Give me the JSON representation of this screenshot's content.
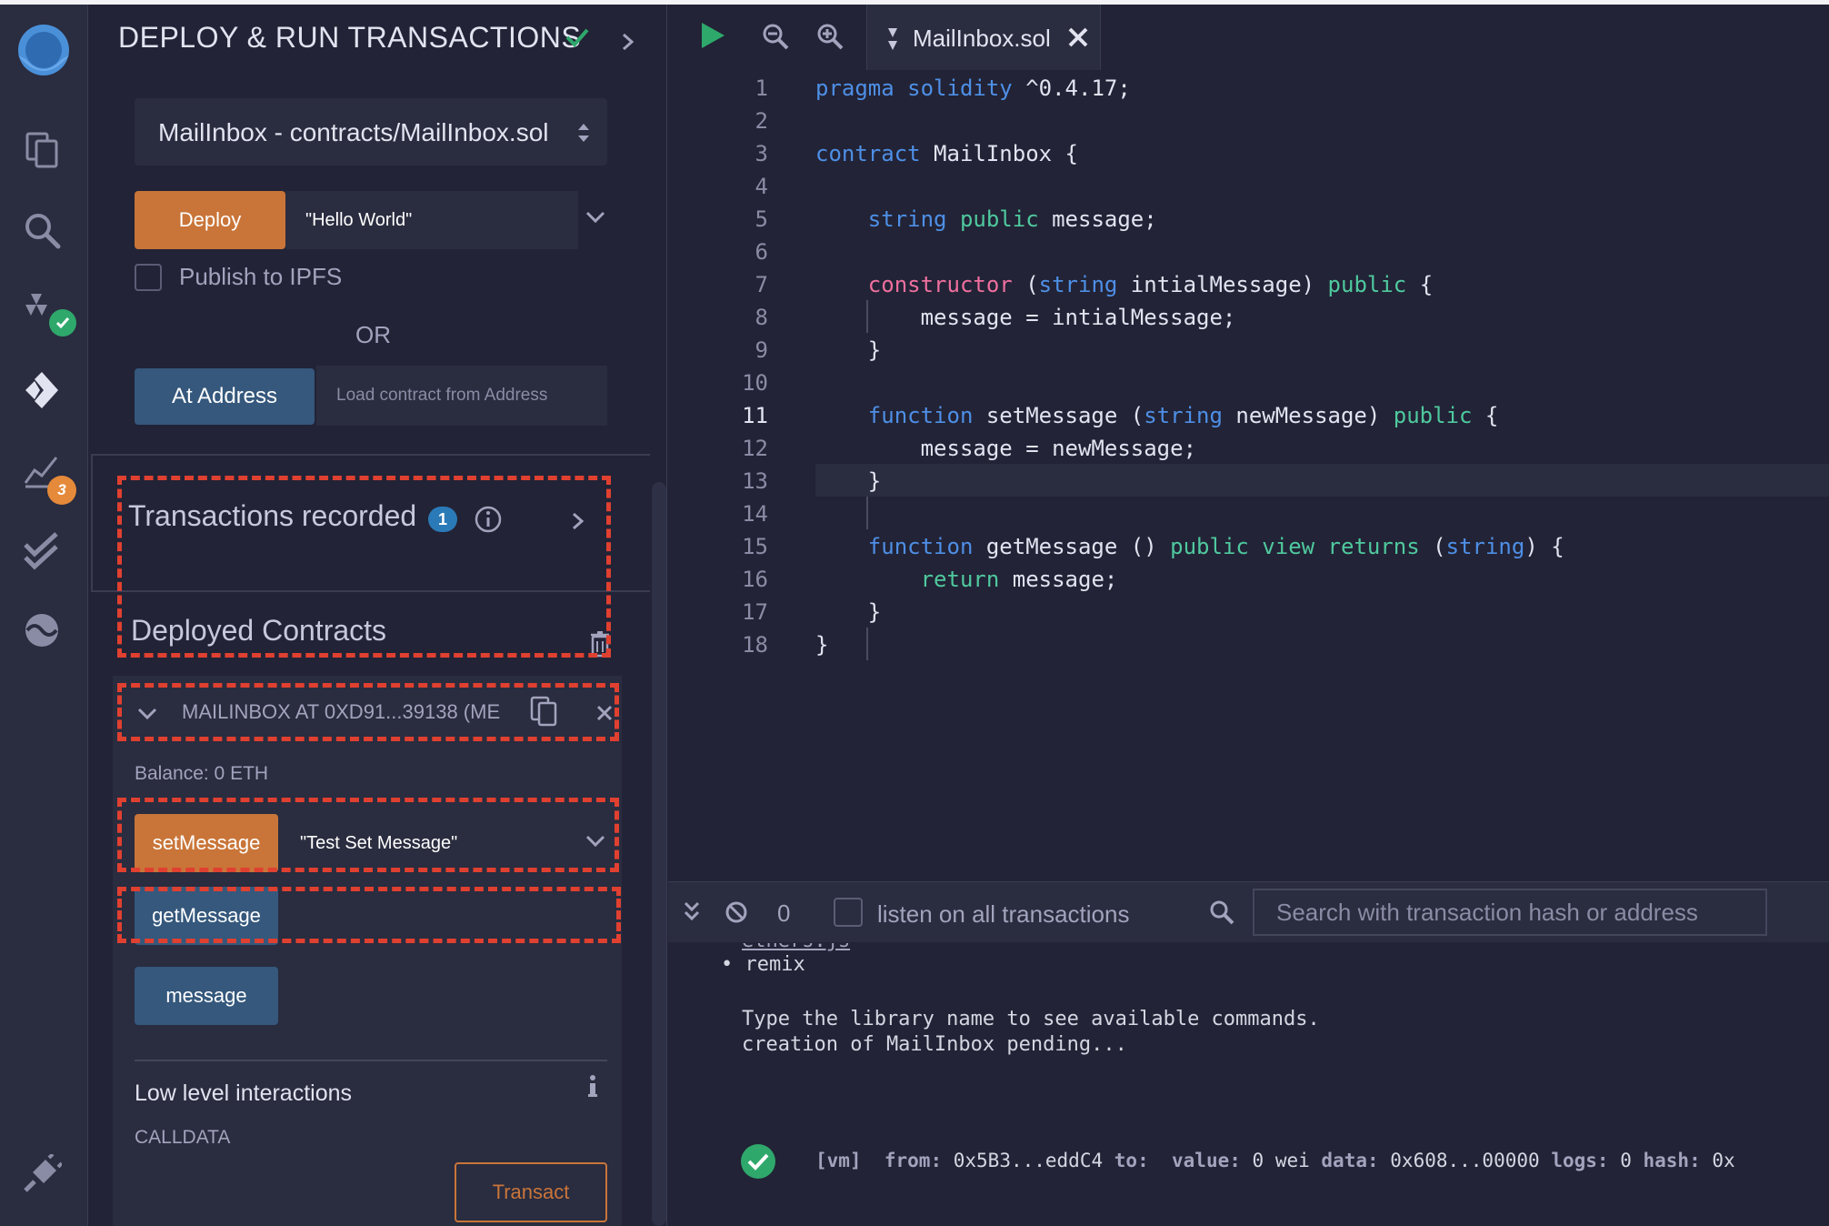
{
  "panel": {
    "title": "DEPLOY & RUN TRANSACTIONS",
    "contract_select": "MailInbox - contracts/MailInbox.sol",
    "deploy_label": "Deploy",
    "deploy_value": "\"Hello World\"",
    "publish_label": "Publish to IPFS",
    "or_label": "OR",
    "at_address_label": "At Address",
    "at_address_placeholder": "Load contract from Address",
    "transactions_recorded": "Transactions recorded",
    "transactions_count": "1",
    "deployed_contracts": "Deployed Contracts",
    "instance_name": "MAILINBOX AT 0XD91...39138 (ME",
    "balance": "Balance: 0 ETH",
    "set_message_label": "setMessage",
    "set_message_value": "\"Test Set Message\"",
    "get_message_label": "getMessage",
    "message_label": "message",
    "low_level": "Low level interactions",
    "calldata": "CALLDATA",
    "transact_label": "Transact"
  },
  "rail": {
    "badge_count": "3",
    "icons": [
      "remix-logo-icon",
      "file-explorer-icon",
      "search-icon",
      "solidity-compiler-icon",
      "deploy-icon",
      "analysis-icon",
      "test-icon",
      "debugger-icon",
      "settings-plug-icon"
    ]
  },
  "editor": {
    "tab_name": "MailInbox.sol",
    "current_line": 11,
    "lines": [
      {
        "n": "1",
        "html": "<span class='k-blue'>pragma</span> <span class='k-blue'>solidity</span> ^0.4.17;"
      },
      {
        "n": "2",
        "html": ""
      },
      {
        "n": "3",
        "html": "<span class='k-blue'>contract</span> MailInbox {"
      },
      {
        "n": "4",
        "html": ""
      },
      {
        "n": "5",
        "html": "    <span class='k-blue'>string</span> <span class='k-green'>public</span> message;"
      },
      {
        "n": "6",
        "html": ""
      },
      {
        "n": "7",
        "html": "    <span class='k-pink'>constructor</span> (<span class='k-blue'>string</span> intialMessage) <span class='k-green'>public</span> {"
      },
      {
        "n": "8",
        "html": "        message = intialMessage;"
      },
      {
        "n": "9",
        "html": "    }"
      },
      {
        "n": "10",
        "html": ""
      },
      {
        "n": "11",
        "html": "    <span class='k-blue'>function</span> setMessage (<span class='k-blue'>string</span> newMessage) <span class='k-green'>public</span> {"
      },
      {
        "n": "12",
        "html": "        message = newMessage;"
      },
      {
        "n": "13",
        "html": "    }"
      },
      {
        "n": "14",
        "html": ""
      },
      {
        "n": "15",
        "html": "    <span class='k-blue'>function</span> getMessage () <span class='k-green'>public</span> <span class='k-green'>view</span> <span class='k-green'>returns</span> (<span class='k-blue'>string</span>) {"
      },
      {
        "n": "16",
        "html": "        <span class='k-green'>return</span> message;"
      },
      {
        "n": "17",
        "html": "    }"
      },
      {
        "n": "18",
        "html": "}"
      }
    ]
  },
  "terminal": {
    "count": "0",
    "listen_label": "listen on all transactions",
    "search_placeholder": "Search with transaction hash or address",
    "line_partial": "ethers.js",
    "line_remix": "• remix",
    "line_type": "Type the library name to see available commands.",
    "line_pending": "creation of MailInbox pending...",
    "log_vm": "[vm]",
    "log_from_label": "from:",
    "log_from": "0x5B3...eddC4",
    "log_to_label": "to:",
    "log_value_label": "value:",
    "log_value": "0 wei",
    "log_data_label": "data:",
    "log_data": "0x608...00000",
    "log_logs_label": "logs:",
    "log_logs": "0",
    "log_hash_label": "hash:",
    "log_hash": "0x"
  },
  "colors": {
    "accent_orange": "#c97539",
    "accent_blue": "#35587c",
    "highlight_red": "#e04030",
    "success_green": "#2fa86b"
  }
}
